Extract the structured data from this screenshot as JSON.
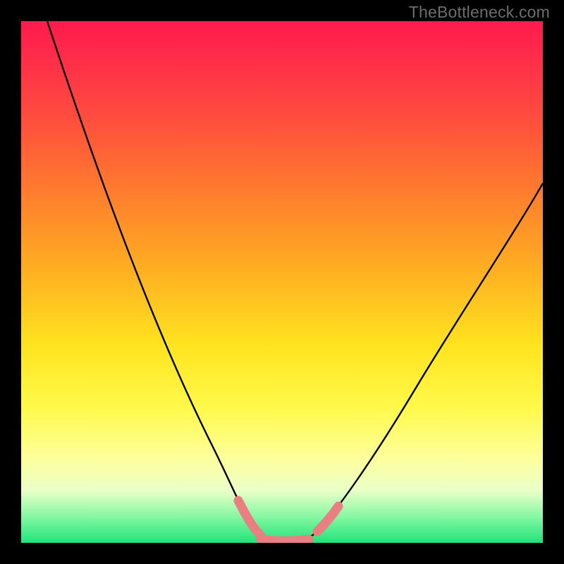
{
  "watermark": "TheBottleneck.com",
  "colors": {
    "frame": "#000000",
    "curve": "#000000",
    "highlight": "#e97f80",
    "gradient_stops": [
      "#ff1a4d",
      "#ff2a4a",
      "#ff4b3f",
      "#ff7a2e",
      "#ffb022",
      "#ffe31f",
      "#fff94a",
      "#fdff9d",
      "#eaffc8",
      "#86f7a3",
      "#1fe47a"
    ]
  },
  "chart_data": {
    "type": "line",
    "title": "",
    "xlabel": "",
    "ylabel": "",
    "xlim": [
      0,
      100
    ],
    "ylim": [
      0,
      100
    ],
    "note": "Axes are unlabeled; x and y expressed as 0-100 percent of plot width/height (y=0 at bottom, y=100 at top). Values estimated from pixels.",
    "series": [
      {
        "name": "bottleneck-curve",
        "x": [
          5,
          10,
          15,
          20,
          25,
          30,
          35,
          40,
          43,
          46,
          50,
          53,
          56,
          60,
          65,
          70,
          75,
          80,
          85,
          90,
          95,
          100
        ],
        "y": [
          100,
          86,
          72,
          58,
          45,
          33,
          22,
          12,
          6,
          2,
          0.5,
          0.5,
          1,
          4,
          10,
          18,
          27,
          36,
          45,
          54,
          62,
          69
        ]
      }
    ],
    "highlight_segments": [
      {
        "name": "left-flank",
        "x": [
          42,
          46
        ],
        "y": [
          8,
          1
        ]
      },
      {
        "name": "trough",
        "x": [
          46,
          55
        ],
        "y": [
          0.5,
          0.5
        ]
      },
      {
        "name": "right-flank",
        "x": [
          56,
          60
        ],
        "y": [
          1.5,
          5
        ]
      }
    ]
  }
}
